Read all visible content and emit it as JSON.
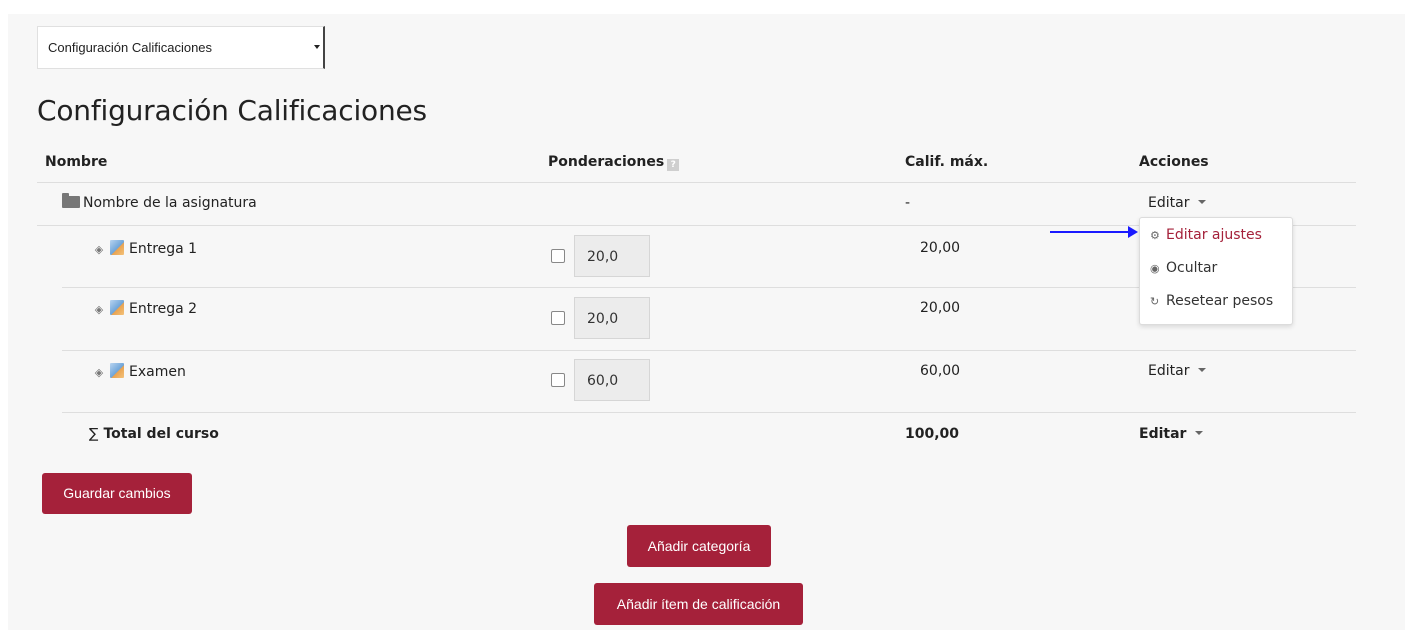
{
  "selector": {
    "value": "Configuración Calificaciones"
  },
  "page_title": "Configuración Calificaciones",
  "table": {
    "headers": {
      "name": "Nombre",
      "weights": "Ponderaciones",
      "max": "Calif. máx.",
      "actions": "Acciones"
    },
    "category": {
      "name": "Nombre de la asignatura",
      "max": "-",
      "action": "Editar"
    },
    "items": [
      {
        "name": "Entrega 1",
        "weight": "20,0",
        "max": "20,00"
      },
      {
        "name": "Entrega 2",
        "weight": "20,0",
        "max": "20,00"
      },
      {
        "name": "Examen",
        "weight": "60,0",
        "max": "60,00",
        "action": "Editar"
      }
    ],
    "total": {
      "symbol": "∑",
      "name": "Total del curso",
      "max": "100,00",
      "action": "Editar"
    }
  },
  "dropdown": {
    "items": [
      {
        "label": "Editar ajustes",
        "icon": "gear-icon",
        "color": "#a5213a"
      },
      {
        "label": "Ocultar",
        "icon": "eye-icon"
      },
      {
        "label": "Resetear pesos",
        "icon": "reset-icon"
      }
    ]
  },
  "buttons": {
    "save": "Guardar cambios",
    "add_category": "Añadir categoría",
    "add_item": "Añadir ítem de calificación"
  },
  "colors": {
    "accent": "#a5213a",
    "arrow": "#1a1aff"
  }
}
